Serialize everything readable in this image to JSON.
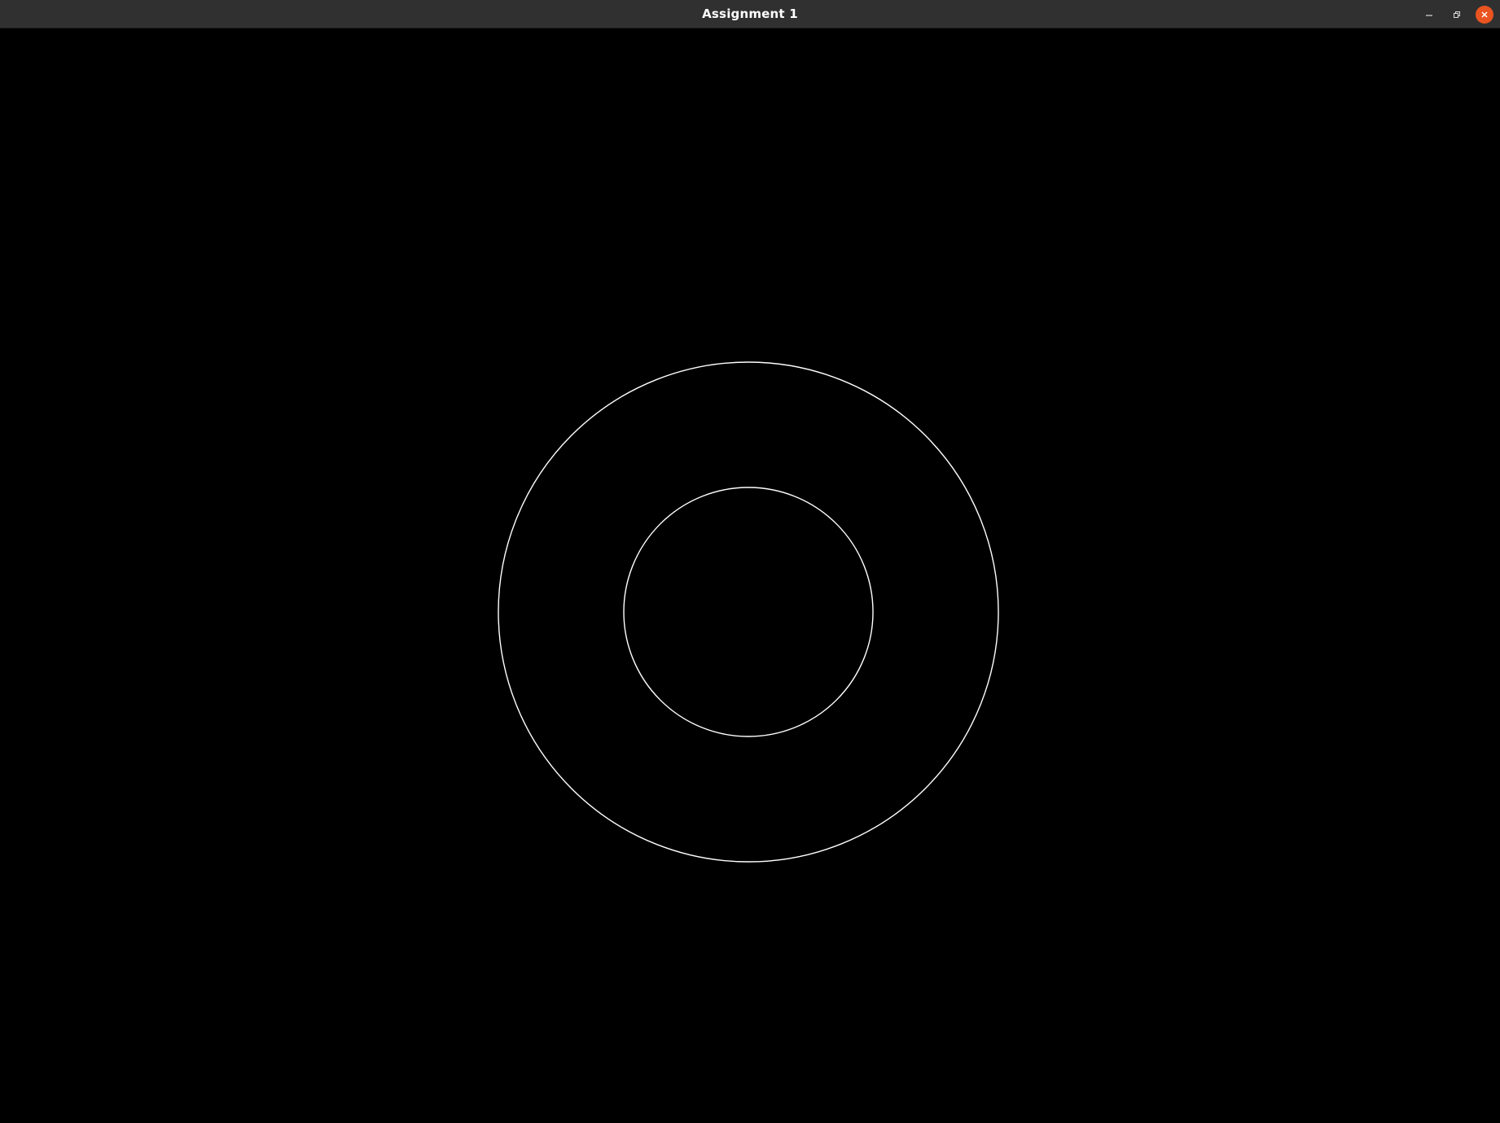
{
  "window": {
    "title": "Assignment 1",
    "controls": {
      "minimize_icon": "minimize-icon",
      "restore_icon": "restore-icon",
      "close_icon": "close-icon",
      "close_color": "#e95420"
    }
  },
  "canvas": {
    "background": "#000000",
    "stroke_color": "#ffffff",
    "shapes": [
      "outer-circle",
      "inner-circle"
    ]
  }
}
